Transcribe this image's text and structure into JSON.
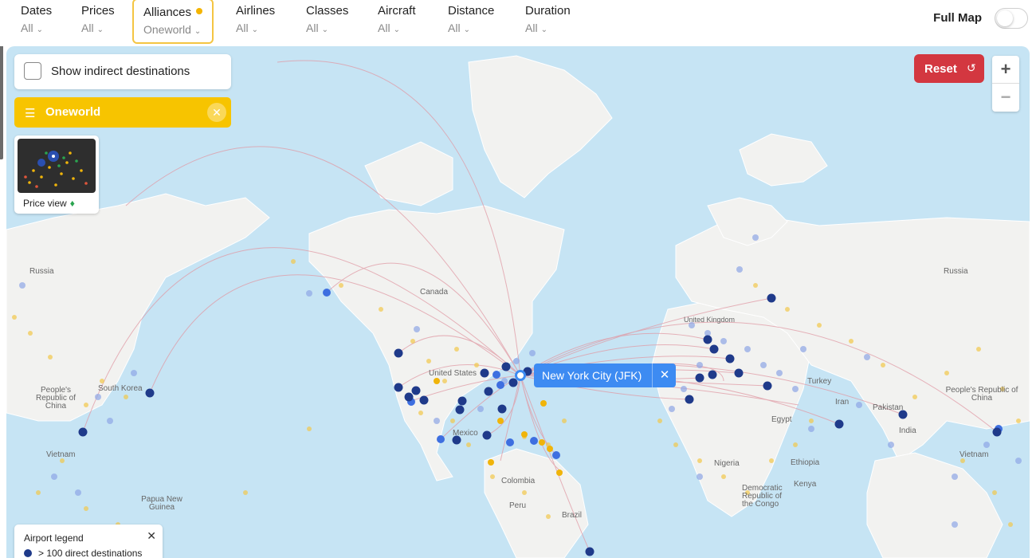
{
  "filters": [
    {
      "title": "Dates",
      "value": "All"
    },
    {
      "title": "Prices",
      "value": "All"
    },
    {
      "title": "Alliances",
      "value": "Oneworld"
    },
    {
      "title": "Airlines",
      "value": "All"
    },
    {
      "title": "Classes",
      "value": "All"
    },
    {
      "title": "Aircraft",
      "value": "All"
    },
    {
      "title": "Distance",
      "value": "All"
    },
    {
      "title": "Duration",
      "value": "All"
    }
  ],
  "full_map": {
    "label": "Full Map",
    "enabled": false
  },
  "indirect": {
    "label": "Show indirect destinations",
    "checked": false
  },
  "alliance_chip": {
    "label": "Oneworld",
    "color": "#f7c400"
  },
  "price_view": {
    "label": "Price view"
  },
  "reset": {
    "label": "Reset",
    "color": "#d33740"
  },
  "zoom": {
    "in": "+",
    "out": "−"
  },
  "origin": {
    "label": "New York City (JFK)",
    "color": "#3d8bf2"
  },
  "legend": {
    "title": "Airport legend",
    "items": [
      {
        "label": "> 100 direct destinations",
        "color": "#1f3a8a"
      }
    ]
  },
  "map_labels": [
    "Russia",
    "Canada",
    "United Kingdom",
    "United States",
    "Mexico",
    "Colombia",
    "Peru",
    "Brazil",
    "Nigeria",
    "Ethiopia",
    "Kenya",
    "Democratic Republic of the Congo",
    "Egypt",
    "Turkey",
    "Iran",
    "Pakistan",
    "India",
    "People's Republic of China",
    "Vietnam",
    "Papua New Guinea",
    "Russia",
    "People's Republic of China",
    "Vietnam",
    "South Korea"
  ]
}
